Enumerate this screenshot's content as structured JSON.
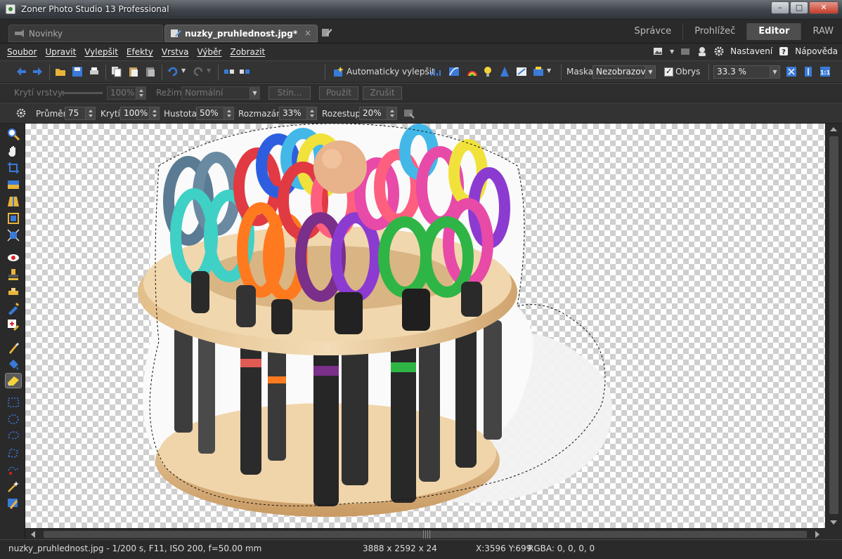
{
  "window": {
    "title": "Zoner Photo Studio 13 Professional",
    "controls": {
      "minimize": "–",
      "maximize": "□",
      "close": "✕"
    }
  },
  "tabs": {
    "items": [
      {
        "label": "Novinky",
        "icon": "news-icon"
      },
      {
        "label": "nuzky_pruhlednost.jpg*",
        "icon": "edit-document-icon",
        "close": "×"
      }
    ]
  },
  "modes": {
    "items": [
      "Správce",
      "Prohlížeč",
      "Editor",
      "RAW"
    ],
    "active": "Editor"
  },
  "menubar": {
    "items": [
      "Soubor",
      "Upravit",
      "Vylepšit",
      "Efekty",
      "Vrstva",
      "Výběr",
      "Zobrazit"
    ],
    "settings_label": "Nastavení",
    "help_label": "Nápověda"
  },
  "toolbar_main": {
    "auto_enhance_label": "Automaticky vylepšit",
    "mask_label": "Maska:",
    "mask_value": "Nezobrazovat",
    "outline_label": "Obrys",
    "outline_checked": true,
    "zoom_value": "33.3 %"
  },
  "toolbar_layer": {
    "opacity_label": "Krytí vrstvy:",
    "opacity_value": "100%",
    "mode_label": "Režim:",
    "mode_value": "Normální",
    "shadow_button": "Stín...",
    "apply_button": "Použít",
    "cancel_button": "Zrušit"
  },
  "toolbar_brush": {
    "diameter_label": "Průměr:",
    "diameter_value": "75",
    "opacity_label": "Krytí:",
    "opacity_value": "100%",
    "density_label": "Hustota:",
    "density_value": "50%",
    "blur_label": "Rozmazání:",
    "blur_value": "33%",
    "spacing_label": "Rozestup:",
    "spacing_value": "20%"
  },
  "statusbar": {
    "file_info": "nuzky_pruhlednost.jpg - 1/200 s, F11, ISO 200, f=50.00 mm",
    "dimensions": "3888 x 2592 x 24",
    "coords": "X:3596 Y:699",
    "rgba": "RGBA: 0, 0, 0, 0"
  },
  "colors": {
    "accent_blue": "#3a7ad8",
    "scissor_colors": [
      "#5a7b93",
      "#3fd0c6",
      "#ff7a1e",
      "#e13a43",
      "#7a2f8a",
      "#2fb545",
      "#e84aa8",
      "#f0e23a",
      "#2e5ee0",
      "#8c3bd0",
      "#ff5f7f",
      "#43b8e8"
    ]
  }
}
